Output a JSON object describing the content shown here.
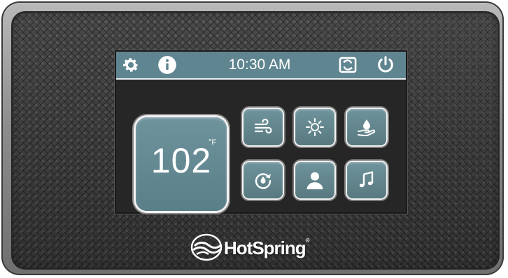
{
  "topbar": {
    "time": "10:30 AM",
    "icons": [
      "gear-icon",
      "info-icon",
      "refresh-icon",
      "power-icon"
    ]
  },
  "temperature": {
    "value": "102",
    "unit": "°F"
  },
  "buttons": [
    {
      "name": "jets-button",
      "icon": "wind-icon"
    },
    {
      "name": "light-button",
      "icon": "sun-icon"
    },
    {
      "name": "water-care-button",
      "icon": "water-drop-hand-icon"
    },
    {
      "name": "clean-cycle-button",
      "icon": "cycle-drop-icon"
    },
    {
      "name": "user-button",
      "icon": "user-icon"
    },
    {
      "name": "music-button",
      "icon": "music-note-icon"
    }
  ],
  "brand": {
    "name": "HotSpring",
    "reg": "®"
  },
  "colors": {
    "accent": "#5f8590",
    "tile": "#6a8f98",
    "screen_bg": "#262626"
  }
}
